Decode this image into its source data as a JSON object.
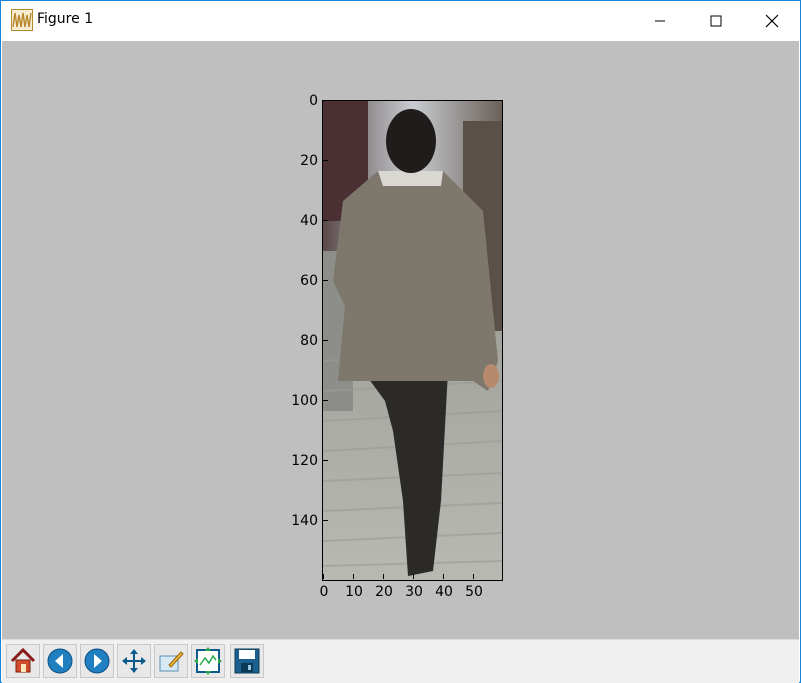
{
  "window": {
    "title": "Figure 1",
    "controls": [
      "minimize-icon",
      "maximize-icon",
      "close-icon"
    ]
  },
  "figure": {
    "background": "#bfbfbf",
    "image_description_colors": {
      "jacket": "#7d776c",
      "trousers": "#2b2a28",
      "pavement": "#a8a8a2"
    }
  },
  "chart_data": {
    "type": "image",
    "x_ticks": [
      "0",
      "10",
      "20",
      "30",
      "40",
      "50"
    ],
    "y_ticks": [
      "0",
      "20",
      "40",
      "60",
      "80",
      "100",
      "120",
      "140"
    ],
    "xlim": [
      0,
      60
    ],
    "ylim": [
      160,
      0
    ]
  },
  "toolbar": {
    "buttons": [
      "home-icon",
      "back-icon",
      "forward-icon",
      "pan-icon",
      "edit-axis-icon",
      "subplots-icon",
      "save-icon"
    ]
  }
}
